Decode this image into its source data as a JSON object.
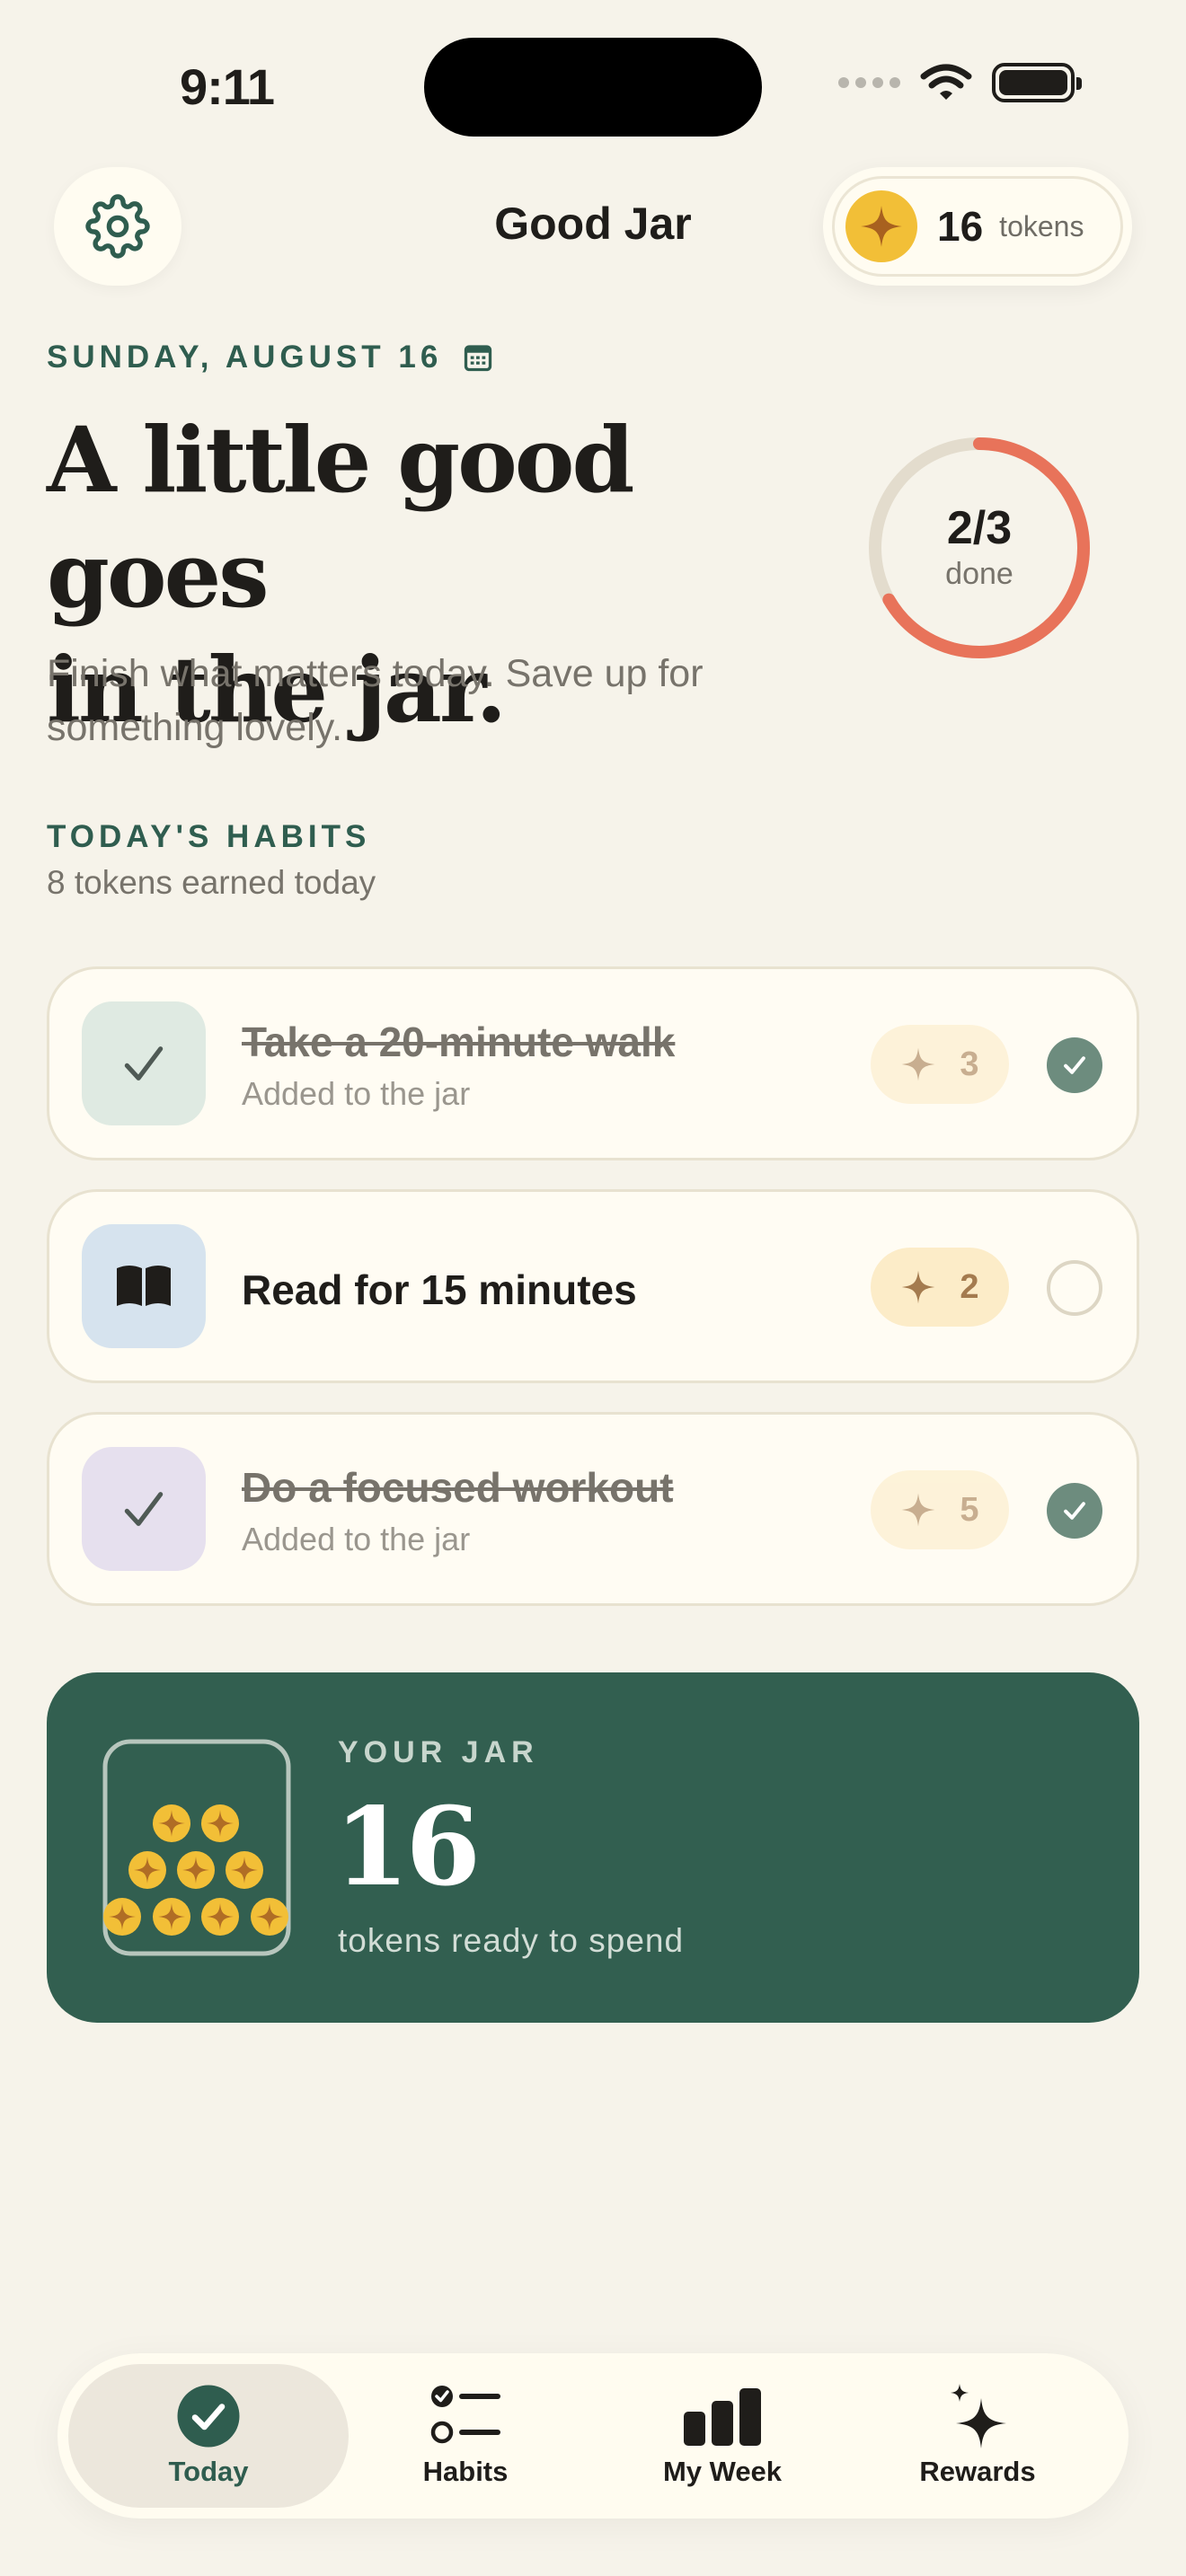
{
  "status_bar": {
    "time": "9:11"
  },
  "header": {
    "title": "Good Jar",
    "token_count": "16",
    "token_word": "tokens"
  },
  "hero": {
    "date": "SUNDAY, AUGUST 16",
    "headline_line1": "A little good goes",
    "headline_line2": "in the jar.",
    "subtitle": "Finish what matters today. Save up for something lovely.",
    "progress_value": "2/3",
    "progress_label": "done",
    "progress_fraction": 0.667
  },
  "habits_section": {
    "title": "TODAY'S HABITS",
    "subtitle": "8 tokens earned today"
  },
  "habits": [
    {
      "name": "Take a 20-minute walk",
      "note": "Added to the jar",
      "tokens": "3",
      "done": true,
      "icon": "checkmark-icon"
    },
    {
      "name": "Read for 15 minutes",
      "note": "",
      "tokens": "2",
      "done": false,
      "icon": "book-icon"
    },
    {
      "name": "Do a focused workout",
      "note": "Added to the jar",
      "tokens": "5",
      "done": true,
      "icon": "checkmark-icon"
    }
  ],
  "jar": {
    "label": "YOUR JAR",
    "value": "16",
    "subtitle": "tokens ready to spend"
  },
  "tabs": [
    {
      "label": "Today",
      "icon": "check-circle-icon",
      "active": true
    },
    {
      "label": "Habits",
      "icon": "checklist-icon",
      "active": false
    },
    {
      "label": "My Week",
      "icon": "bar-chart-icon",
      "active": false
    },
    {
      "label": "Rewards",
      "icon": "sparkles-icon",
      "active": false
    }
  ],
  "colors": {
    "background": "#f6f3ea",
    "accent_green": "#2f5d4f",
    "progress_orange": "#e8735a",
    "coin_gold": "#f2bf37"
  }
}
